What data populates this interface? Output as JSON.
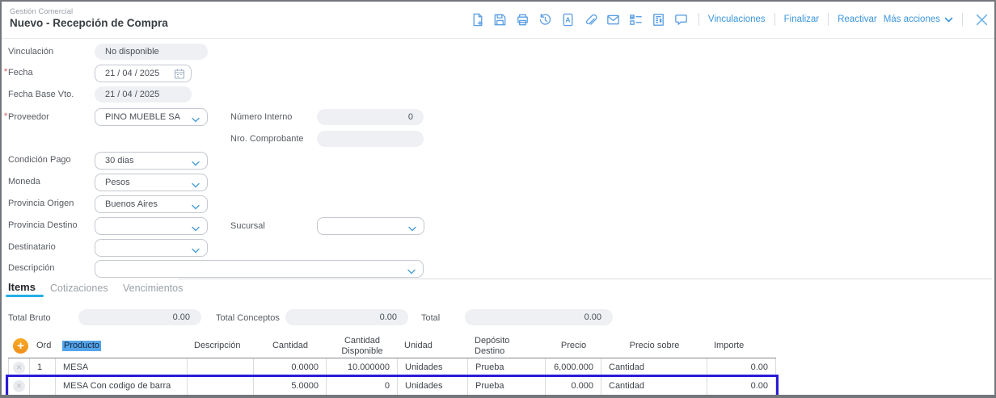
{
  "header": {
    "app_title": "Gestión Comercial",
    "page_title": "Nuevo - Recepción de Compra",
    "toolbar_icons": [
      "new-document",
      "save",
      "print",
      "history",
      "document-a",
      "attachment",
      "email",
      "checklist",
      "journal",
      "comment"
    ],
    "action_links": [
      "Vinculaciones",
      "Finalizar",
      "Reactivar"
    ],
    "more_actions_label": "Más acciones"
  },
  "form": {
    "vinculacion": {
      "label": "Vinculación",
      "value": "No disponible"
    },
    "fecha": {
      "label": "Fecha",
      "value": "21 / 04 / 2025",
      "required": true
    },
    "fecha_base_vto": {
      "label": "Fecha Base Vto.",
      "value": "21 / 04 / 2025"
    },
    "proveedor": {
      "label": "Proveedor",
      "value": "PINO MUEBLE SA",
      "required": true
    },
    "numero_interno": {
      "label": "Número Interno",
      "value": "0"
    },
    "nro_comprobante": {
      "label": "Nro. Comprobante",
      "value": ""
    },
    "condicion_pago": {
      "label": "Condición Pago",
      "value": "30 dias"
    },
    "moneda": {
      "label": "Moneda",
      "value": "Pesos"
    },
    "provincia_origen": {
      "label": "Provincia Origen",
      "value": "Buenos Aires"
    },
    "provincia_destino": {
      "label": "Provincia Destino",
      "value": ""
    },
    "sucursal": {
      "label": "Sucursal",
      "value": ""
    },
    "destinatario": {
      "label": "Destinatario",
      "value": ""
    },
    "descripcion": {
      "label": "Descripción",
      "value": ""
    }
  },
  "tabs": [
    {
      "label": "Items",
      "active": true
    },
    {
      "label": "Cotizaciones",
      "active": false
    },
    {
      "label": "Vencimientos",
      "active": false
    }
  ],
  "totals": [
    {
      "label": "Total Bruto",
      "value": "0.00"
    },
    {
      "label": "Total Conceptos",
      "value": "0.00"
    },
    {
      "label": "Total",
      "value": "0.00"
    }
  ],
  "items_table": {
    "columns": [
      "",
      "Ord",
      "Producto",
      "Descripción",
      "Cantidad",
      "Cantidad Disponible",
      "Unidad",
      "Depósito Destino",
      "Precio",
      "Precio sobre",
      "Importe"
    ],
    "highlighted_column": "Producto",
    "rows": [
      {
        "selected": false,
        "cells": [
          "1",
          "MESA",
          "",
          "0.0000",
          "10.000000",
          "Unidades",
          "Prueba",
          "6,000.000",
          "Cantidad",
          "0.00"
        ]
      },
      {
        "selected": true,
        "cells": [
          "",
          "MESA Con codigo de barra",
          "",
          "5.0000",
          "0",
          "Unidades",
          "Prueba",
          "0.000",
          "Cantidad",
          "0.00"
        ]
      }
    ]
  },
  "colors": {
    "accent_blue": "#3b95de",
    "tab_underline": "#23b0e8",
    "selected_row_border": "#2a1bd7",
    "add_button_orange": "#f39c1d",
    "producto_highlight": "#55a5ea"
  }
}
